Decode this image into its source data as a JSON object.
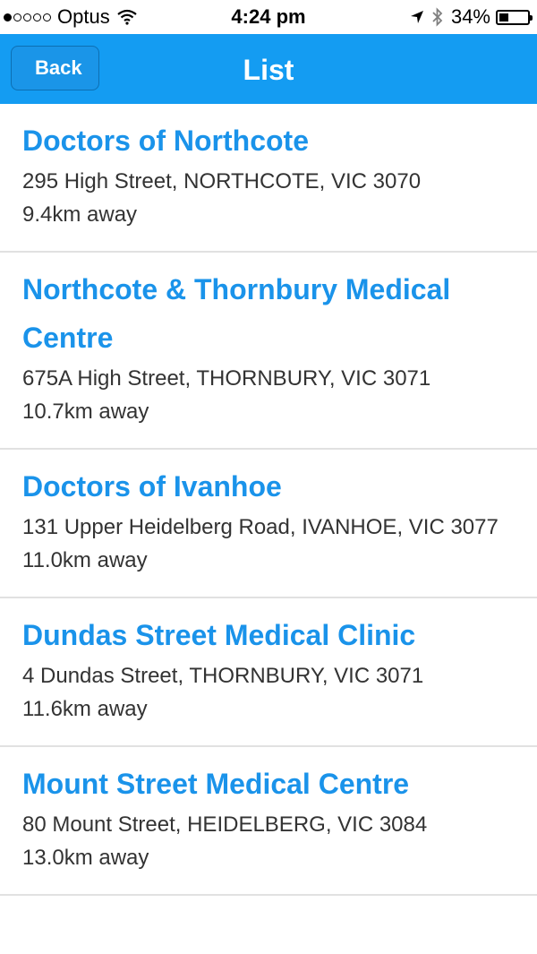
{
  "status_bar": {
    "carrier": "Optus",
    "time": "4:24 pm",
    "battery_percent": "34%",
    "signal_strength": 1,
    "battery_level": 0.34,
    "icons": [
      "wifi-icon",
      "location-icon",
      "bluetooth-icon",
      "battery-icon"
    ]
  },
  "nav": {
    "back_label": "Back",
    "title": "List",
    "bar_color": "#149cf2"
  },
  "items": [
    {
      "name": "Doctors of Northcote",
      "address": "295 High Street, NORTHCOTE, VIC 3070",
      "distance": "9.4km away"
    },
    {
      "name": "Northcote & Thornbury Medical Centre",
      "address": "675A High Street, THORNBURY, VIC 3071",
      "distance": "10.7km away"
    },
    {
      "name": "Doctors of Ivanhoe",
      "address": "131 Upper Heidelberg Road, IVANHOE, VIC 3077",
      "distance": "11.0km away"
    },
    {
      "name": "Dundas Street Medical Clinic",
      "address": "4 Dundas Street, THORNBURY, VIC 3071",
      "distance": "11.6km away"
    },
    {
      "name": "Mount Street Medical Centre",
      "address": "80 Mount Street, HEIDELBERG, VIC 3084",
      "distance": "13.0km away"
    }
  ],
  "colors": {
    "accent": "#1a93ea",
    "text": "#333333",
    "divider": "#e1e1e1"
  }
}
